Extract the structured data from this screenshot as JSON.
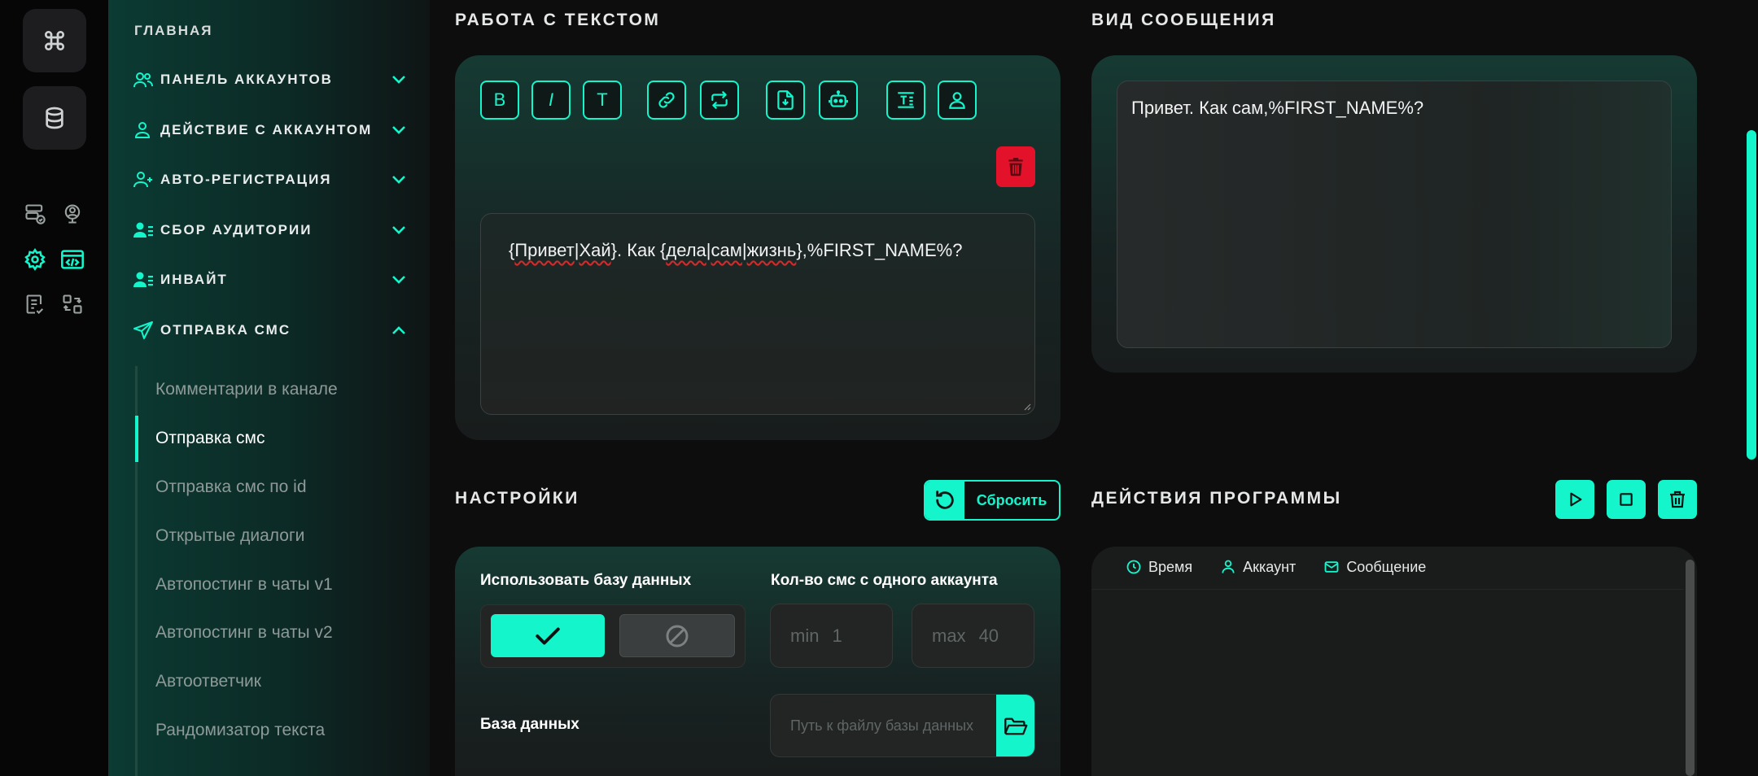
{
  "colors": {
    "accent": "#14f5cc",
    "danger": "#e3122a",
    "bg": "#0d0d0e"
  },
  "rail": {
    "top_buttons": [
      "command-icon",
      "database-icon"
    ],
    "small_icons": [
      "server-check-icon",
      "user-globe-icon",
      "gear-icon",
      "code-window-icon",
      "report-icon",
      "convert-icon"
    ]
  },
  "sidebar": {
    "home": "ГЛАВНАЯ",
    "items": [
      {
        "label": "ПАНЕЛЬ АККАУНТОВ",
        "icon": "users-icon",
        "expanded": false
      },
      {
        "label": "ДЕЙСТВИЕ С АККАУНТОМ",
        "icon": "user-icon",
        "expanded": false
      },
      {
        "label": "АВТО-РЕГИСТРАЦИЯ",
        "icon": "user-plus-icon",
        "expanded": false
      },
      {
        "label": "СБОР АУДИТОРИИ",
        "icon": "user-list-icon",
        "expanded": false
      },
      {
        "label": "ИНВАЙТ",
        "icon": "user-list-icon",
        "expanded": false
      },
      {
        "label": "ОТПРАВКА СМС",
        "icon": "send-icon",
        "expanded": true
      }
    ],
    "subitems": [
      {
        "label": "Комментарии в канале",
        "active": false
      },
      {
        "label": "Отправка смс",
        "active": true
      },
      {
        "label": "Отправка смс по id",
        "active": false
      },
      {
        "label": "Открытые диалоги",
        "active": false
      },
      {
        "label": "Автопостинг в чаты v1",
        "active": false
      },
      {
        "label": "Автопостинг в чаты v2",
        "active": false
      },
      {
        "label": "Автоответчик",
        "active": false
      },
      {
        "label": "Рандомизатор текста",
        "active": false
      }
    ]
  },
  "text_section": {
    "title": "РАБОТА С ТЕКСТОМ",
    "toolbar": [
      {
        "label": "B",
        "icon": "bold-icon"
      },
      {
        "label": "I",
        "icon": "italic-icon"
      },
      {
        "label": "T",
        "icon": "text-icon"
      },
      {
        "label": "",
        "icon": "link-icon"
      },
      {
        "label": "",
        "icon": "repeat-icon"
      },
      {
        "label": "",
        "icon": "file-download-icon"
      },
      {
        "label": "",
        "icon": "robot-icon"
      },
      {
        "label": "",
        "icon": "text-block-icon"
      },
      {
        "label": "",
        "icon": "user-icon"
      }
    ],
    "text_parts": [
      "{",
      "Привет",
      "|",
      "Хай",
      "}. Как {",
      "дела",
      "|",
      "сам",
      "|",
      "жизнь",
      "},%FIRST_NAME%?"
    ]
  },
  "preview_section": {
    "title": "ВИД СООБЩЕНИЯ",
    "text": "Привет. Как сам,%FIRST_NAME%?"
  },
  "settings": {
    "title": "НАСТРОЙКИ",
    "reset_label": "Сбросить",
    "use_db_label": "Использовать базу данных",
    "use_db_value": true,
    "count_label": "Кол-во смс с одного аккаунта",
    "min_label": "min",
    "min_value": "1",
    "max_label": "max",
    "max_value": "40",
    "db_label": "База данных",
    "db_placeholder": "Путь к файлу базы данных"
  },
  "actions": {
    "title": "ДЕЙСТВИЯ ПРОГРАММЫ",
    "buttons": [
      "play-icon",
      "stop-icon",
      "trash-icon"
    ],
    "columns": [
      "Время",
      "Аккаунт",
      "Сообщение"
    ]
  }
}
